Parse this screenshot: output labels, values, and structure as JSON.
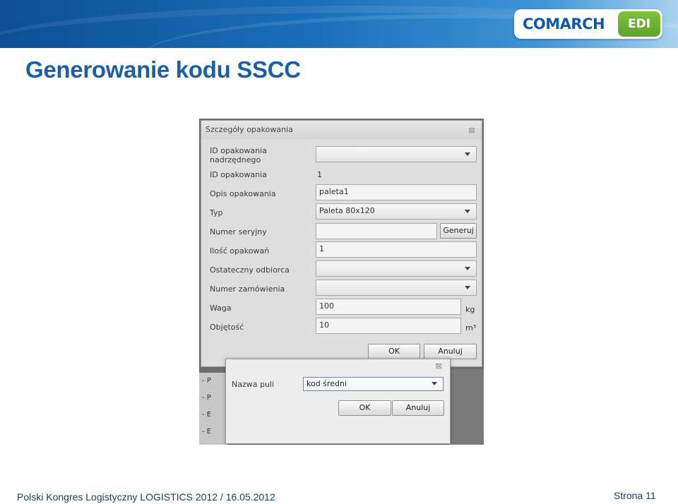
{
  "header": {
    "logo_main": "COMARCH",
    "logo_badge": "EDI"
  },
  "page": {
    "title": "Generowanie kodu SSCC"
  },
  "dialog_main": {
    "title": "Szczegóły opakowania",
    "fields": {
      "parent_id_label_line1": "ID opakowania",
      "parent_id_label_line2": "nadrzędnego",
      "parent_id_value": "",
      "id_label": "ID opakowania",
      "id_value": "1",
      "description_label": "Opis opakowania",
      "description_value": "paleta1",
      "type_label": "Typ",
      "type_value": "Paleta 80x120",
      "serial_label": "Numer seryjny",
      "serial_value": "",
      "generate_button": "Generuj",
      "quantity_label": "Ilość opakowań",
      "quantity_value": "1",
      "recipient_label": "Ostateczny odbiorca",
      "recipient_value": "",
      "order_label": "Numer zamówienia",
      "order_value": "",
      "weight_label": "Waga",
      "weight_value": "100",
      "weight_unit": "kg",
      "volume_label": "Objętość",
      "volume_value": "10",
      "volume_unit": "m³"
    },
    "ok_button": "OK",
    "cancel_button": "Anuluj"
  },
  "dialog_pool": {
    "label": "Nazwa puli",
    "selected": "kod średni",
    "ok_button": "OK",
    "cancel_button": "Anuluj"
  },
  "background_list": [
    "- P",
    "- P",
    "- E",
    "- E"
  ],
  "footer": {
    "left": "Polski Kongres Logistyczny LOGISTICS 2012 / 16.05.2012",
    "right": "Strona 11"
  },
  "colors": {
    "title_blue": "#1d5fa6",
    "header_blue": "#0e4f95",
    "logo_green": "#6cb230"
  }
}
